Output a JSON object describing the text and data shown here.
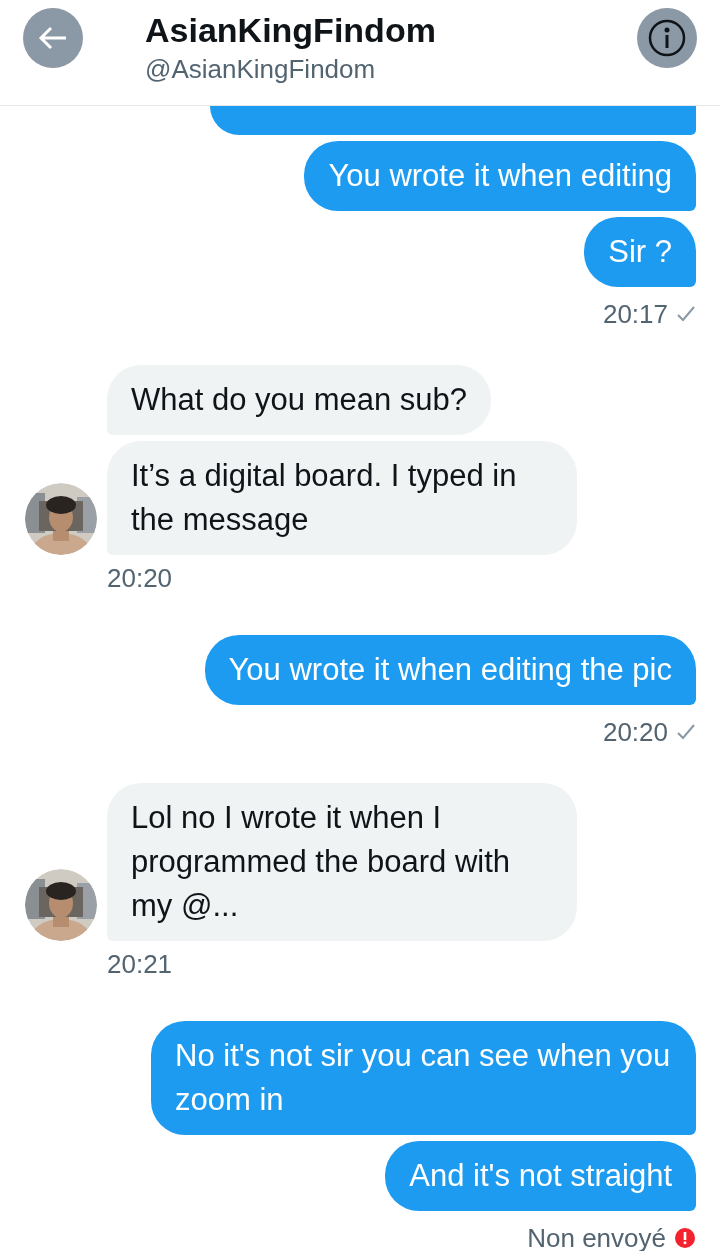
{
  "header": {
    "name": "AsianKingFindom",
    "handle": "@AsianKingFindom"
  },
  "clipped_top_bubble": true,
  "blocks": [
    {
      "kind": "outgoing",
      "messages": [
        "You wrote it when editing",
        "Sir ?"
      ],
      "time": "20:17",
      "sent_check": true
    },
    {
      "kind": "incoming",
      "messages": [
        "What do you mean sub?",
        "It’s a digital board. I typed in the message"
      ],
      "time": "20:20"
    },
    {
      "kind": "outgoing",
      "messages": [
        "You wrote it when editing the pic"
      ],
      "time": "20:20",
      "sent_check": true
    },
    {
      "kind": "incoming",
      "messages": [
        "Lol no I wrote it when I programmed the board with my @..."
      ],
      "time": "20:21"
    },
    {
      "kind": "outgoing",
      "messages": [
        "No it's not sir you can see when you zoom in",
        "And it's not straight"
      ],
      "status": "Non envoyé",
      "error": true
    }
  ]
}
